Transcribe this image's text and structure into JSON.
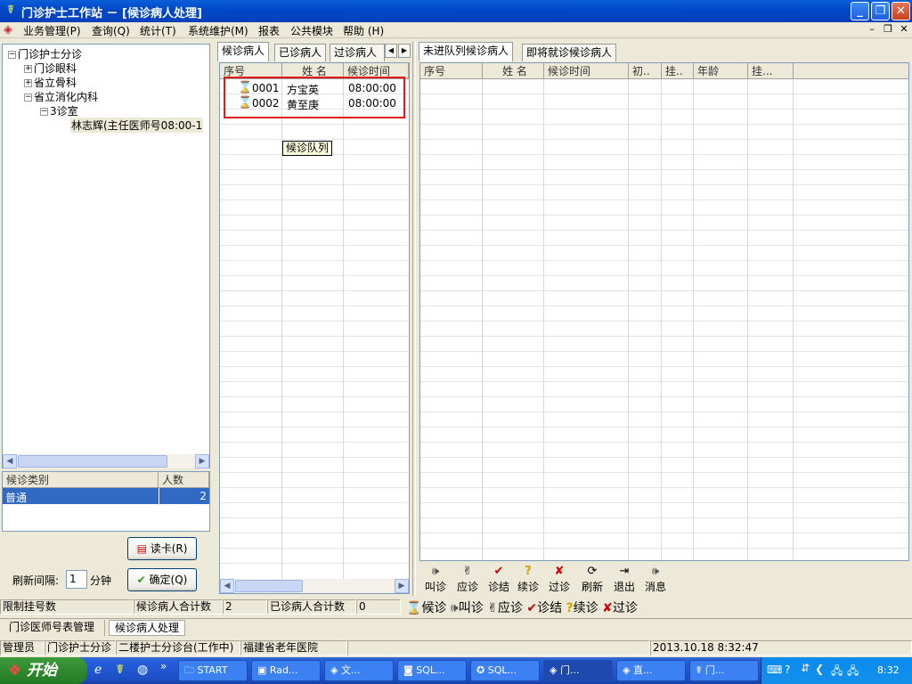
{
  "window": {
    "title": "门诊护士工作站 － [候诊病人处理]",
    "icon": "app-icon"
  },
  "menu": [
    "业务管理(P)",
    "查询(Q)",
    "统计(T)",
    "系统维护(M)",
    "报表",
    "公共模块",
    "帮助 (H)"
  ],
  "tree": {
    "root": "门诊护士分诊",
    "items": [
      "门诊眼科",
      "省立骨科",
      "省立消化内科"
    ],
    "room": "3诊室",
    "doctor": "林志辉(主任医师号08:00-1"
  },
  "category_table": {
    "headers": [
      "候诊类别",
      "人数"
    ],
    "rows": [
      {
        "category": "普通",
        "count": "2"
      }
    ]
  },
  "read_card_button": "读卡(R)",
  "refresh": {
    "label": "刷新间隔:",
    "value": "1",
    "unit": "分钟"
  },
  "confirm_button": "确定(Q)",
  "middle_tabs": [
    "候诊病人",
    "已诊病人",
    "过诊病人"
  ],
  "middle_table": {
    "headers": [
      "序号",
      "姓 名",
      "候诊时间"
    ],
    "rows": [
      {
        "no": "0001",
        "name": "方宝英",
        "time": "08:00:00"
      },
      {
        "no": "0002",
        "name": "黄至庚",
        "time": "08:00:00"
      }
    ],
    "tooltip": "候诊队列"
  },
  "right_tabs": [
    "未进队列候诊病人",
    "即将就诊候诊病人"
  ],
  "right_table": {
    "headers": [
      "序号",
      "姓 名",
      "候诊时间",
      "初..",
      "挂..",
      "年龄",
      "挂..."
    ]
  },
  "right_toolbar": [
    {
      "icon": "speaker-icon",
      "label": "叫诊"
    },
    {
      "icon": "answer-icon",
      "label": "应诊"
    },
    {
      "icon": "check-icon",
      "label": "诊结"
    },
    {
      "icon": "question-icon",
      "label": "续诊"
    },
    {
      "icon": "cross-icon",
      "label": "过诊"
    },
    {
      "icon": "refresh-icon",
      "label": "刷新"
    },
    {
      "icon": "exit-icon",
      "label": "退出"
    },
    {
      "icon": "speaker-icon",
      "label": "消息"
    }
  ],
  "status1": {
    "limit_label": "限制挂号数",
    "waiting_total_label": "候诊病人合计数",
    "waiting_total": "2",
    "seen_total_label": "已诊病人合计数",
    "seen_total": "0",
    "legend": [
      "候诊",
      "叫诊",
      "应诊",
      "诊结",
      "续诊",
      "过诊"
    ]
  },
  "mdi_tabs": [
    "门诊医师号表管理",
    "候诊病人处理"
  ],
  "status2": {
    "user": "管理员",
    "module": "门诊护士分诊",
    "station": "二楼护士分诊台(工作中)",
    "hospital": "福建省老年医院",
    "datetime": "2013.10.18 8:32:47"
  },
  "taskbar": {
    "start": "开始",
    "tasks": [
      "START",
      "Rad...",
      "文...",
      "SQL...",
      "SQL...",
      "门...",
      "直...",
      "门..."
    ],
    "clock": "8:32"
  }
}
